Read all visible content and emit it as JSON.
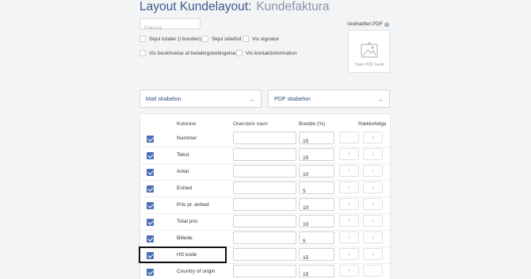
{
  "header": {
    "title": "Layout Kundelayout:",
    "subtitle": "Kundefaktura"
  },
  "name_field": {
    "value": "",
    "placeholder": "Faktura"
  },
  "options": [
    {
      "label": "Skjul totaler (i bunden)",
      "checked": false
    },
    {
      "label": "Skjul sidefod",
      "checked": false
    },
    {
      "label": "Vis signatur",
      "checked": false
    },
    {
      "label": "Vis beskrivelse af betalingsbetingelser",
      "checked": false
    },
    {
      "label": "Vis kontaktinformation",
      "checked": false
    }
  ],
  "attached_pdf": {
    "label": "Vedhæftet PDF",
    "help_glyph": "?",
    "drop_text": "Træk PDF hertil"
  },
  "templates": {
    "mail": "Mail skabelon",
    "pdf": "PDF skabelon",
    "arrow": "→"
  },
  "table": {
    "headers": {
      "column": "Kolonne",
      "override": "Overskriv navn",
      "width": "Bredde (%)",
      "order": "Rækkefølge"
    },
    "up_glyph": "↑",
    "down_glyph": "↓",
    "rows": [
      {
        "name": "Nummer",
        "override": "",
        "width": "15",
        "checked": true
      },
      {
        "name": "Tekst",
        "override": "",
        "width": "15",
        "checked": true
      },
      {
        "name": "Antal",
        "override": "",
        "width": "10",
        "checked": true
      },
      {
        "name": "Enhed",
        "override": "",
        "width": "5",
        "checked": true
      },
      {
        "name": "Pris pr. enhed",
        "override": "",
        "width": "10",
        "checked": true
      },
      {
        "name": "Total pris",
        "override": "",
        "width": "10",
        "checked": true
      },
      {
        "name": "Billede",
        "override": "",
        "width": "5",
        "checked": true
      },
      {
        "name": "HS kode",
        "override": "",
        "width": "15",
        "checked": true
      },
      {
        "name": "Country of origin",
        "override": "",
        "width": "15",
        "checked": true
      }
    ]
  },
  "colors": {
    "accent": "#4a6fb5",
    "title": "#3d5a8a",
    "highlight": "#111111"
  }
}
